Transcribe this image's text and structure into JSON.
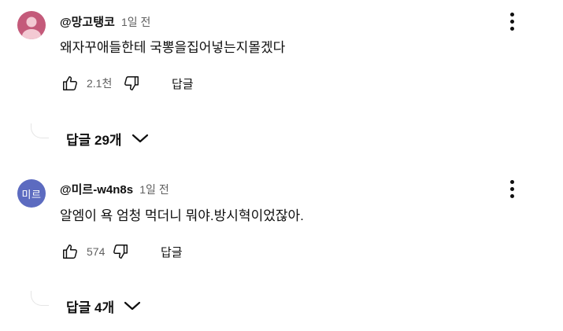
{
  "comments": [
    {
      "author": "@망고탱코",
      "time": "1일 전",
      "text": "왜자꾸애들한테 국뽕을집어넣는지몰겠다",
      "likes": "2.1천",
      "reply_label": "답글",
      "replies_label": "답글 29개",
      "avatar": {
        "type": "person-icon",
        "bg": "#c45a7a",
        "fg": "#f3c9d3"
      }
    },
    {
      "author": "@미르-w4n8s",
      "time": "1일 전",
      "text": "알엠이 욕 엄청 먹더니 뭐야.방시혁이었잖아.",
      "likes": "574",
      "reply_label": "답글",
      "replies_label": "답글 4개",
      "avatar": {
        "type": "initials",
        "text": "미르",
        "bg": "#5c6bc0"
      }
    }
  ],
  "colors": {
    "text": "#0f0f0f",
    "secondary": "#606060"
  }
}
